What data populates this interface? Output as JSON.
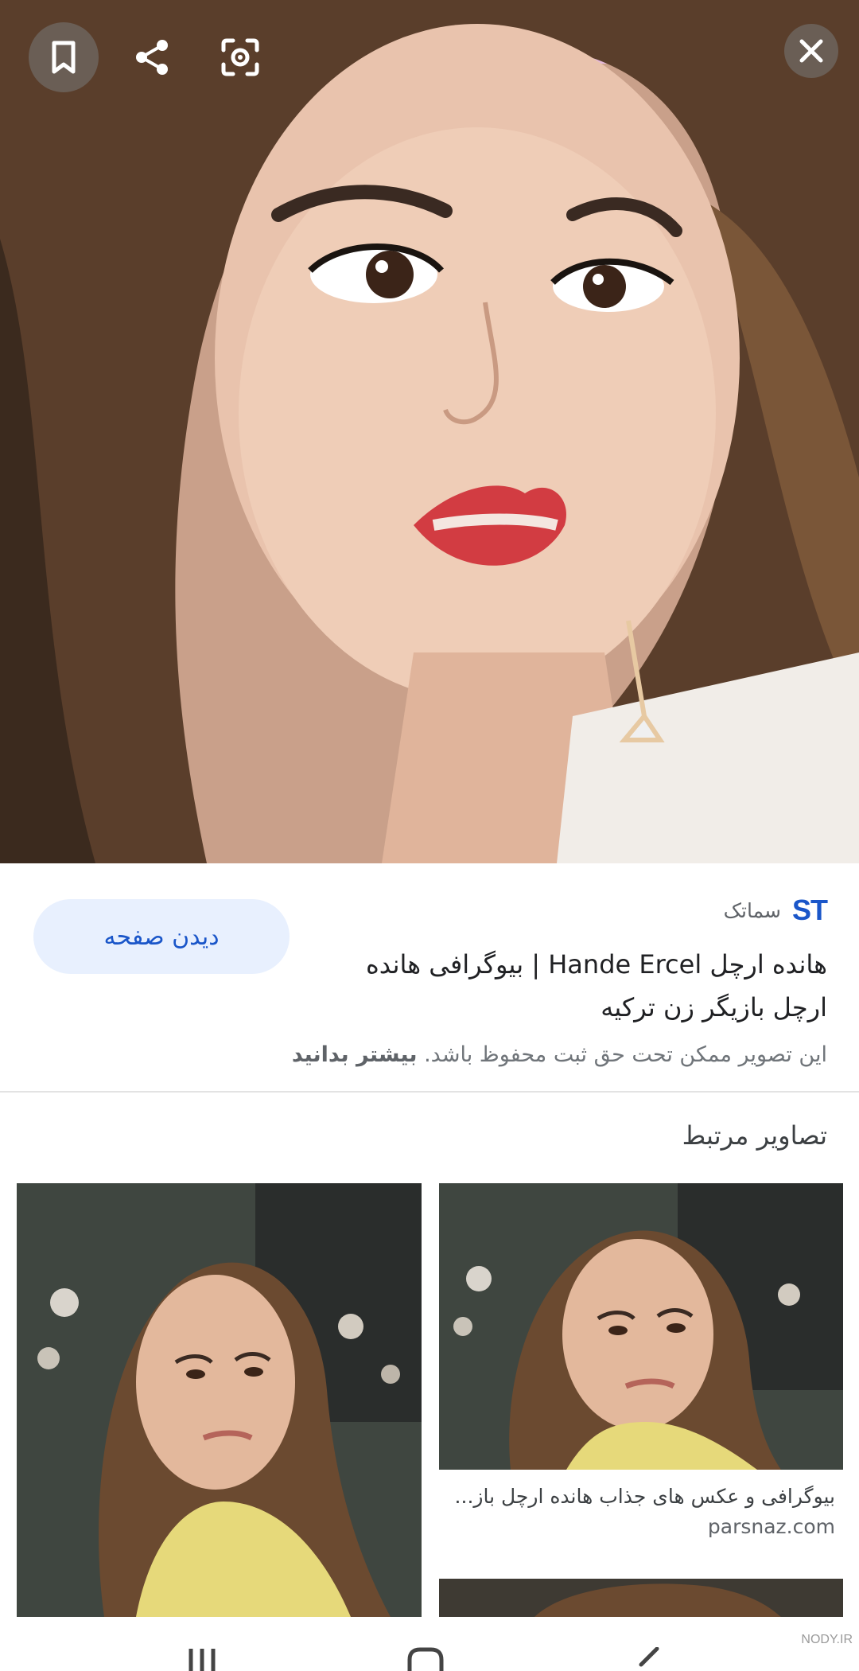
{
  "hero": {
    "alt_icon_names": [
      "bookmark-icon",
      "share-icon",
      "lens-icon",
      "close-icon"
    ]
  },
  "source": {
    "favicon_text": "ST",
    "name": "سماتک"
  },
  "result": {
    "title": "هانده ارچل Hande Ercel | بیوگرافی هانده ارچل بازیگر زن ترکیه",
    "copyright_text": "این تصویر ممکن تحت حق ثبت محفوظ باشد.",
    "learn_more": "بیشتر بدانید",
    "visit_button": "دیدن صفحه"
  },
  "related": {
    "heading": "تصاویر مرتبط",
    "items": [
      {
        "caption": "بیوگرافی و عکس های جذاب هانده ارچل باز...",
        "domain": "parsnaz.com"
      }
    ]
  },
  "navbar": {
    "icons": [
      "recent-apps-icon",
      "home-icon",
      "back-icon"
    ]
  },
  "watermark": {
    "text": "NODY.IR"
  },
  "colors": {
    "accent": "#1a56c9",
    "button_bg": "#e8f0fe",
    "divider": "#e3e3e3"
  }
}
